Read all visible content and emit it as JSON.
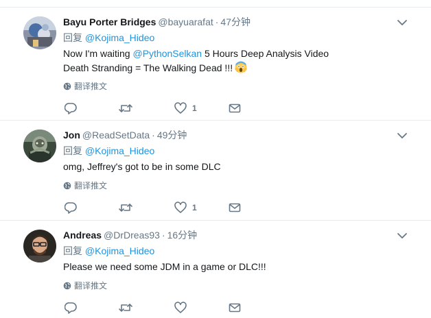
{
  "colors": {
    "link": "#1b95e0",
    "secondary_text": "#657786",
    "primary_text": "#14171a",
    "divider": "#e6ecf0"
  },
  "tweets": [
    {
      "fullname": "Bayu Porter Bridges",
      "username": "@bayuarafat",
      "separator": "·",
      "time": "47分钟",
      "reply_prefix": "回复",
      "reply_to": "@Kojima_Hideo",
      "line1_prefix": "Now I'm waiting ",
      "line1_mention": "@PythonSelkan",
      "line1_suffix": " 5 Hours Deep Analysis Video",
      "line2": "Death Stranding = The Walking Dead !!!",
      "emoji": "scream-emoji",
      "translate_label": "翻译推文",
      "like_count": "1"
    },
    {
      "fullname": "Jon",
      "username": "@ReadSetData",
      "separator": "·",
      "time": "49分钟",
      "reply_prefix": "回复",
      "reply_to": "@Kojima_Hideo",
      "line1": "omg, Jeffrey's got to be in some DLC",
      "translate_label": "翻译推文",
      "like_count": "1"
    },
    {
      "fullname": "Andreas",
      "username": "@DrDreas93",
      "separator": "·",
      "time": "16分钟",
      "reply_prefix": "回复",
      "reply_to": "@Kojima_Hideo",
      "line1": "Please we need some JDM in a game or DLC!!!",
      "translate_label": "翻译推文",
      "like_count": ""
    }
  ]
}
